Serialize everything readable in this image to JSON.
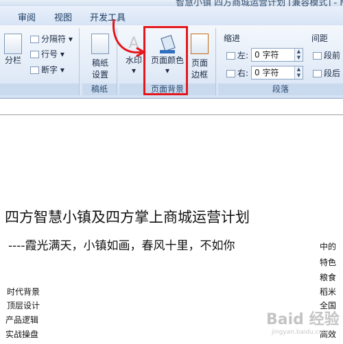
{
  "title_fragment": "智慧小镇 四方商城运营计划 [兼容模式] - Microsoft",
  "tabs": [
    "审阅",
    "视图",
    "开发工具"
  ],
  "ribbon": {
    "layout_buttons": {
      "columns": "分栏",
      "breaks": "分隔符",
      "line_numbers": "行号",
      "hyphenation": "断字"
    },
    "manuscript": {
      "label": "稿纸设置",
      "group": "稿纸"
    },
    "page_background": {
      "watermark": "水印",
      "page_color": "页面颜色",
      "page_borders": "页面边框",
      "group": "页面背景"
    },
    "paragraph": {
      "indent_title": "缩进",
      "left_label": "左:",
      "left_value": "0 字符",
      "right_label": "右:",
      "right_value": "0 字符",
      "spacing_title": "间距",
      "before_label": "段前",
      "after_label": "段后",
      "group": "段落"
    }
  },
  "document": {
    "title": "四方智慧小镇及四方掌上商城运营计划",
    "subtitle": "----霞光满天，小镇如画，春风十里，不如你",
    "outline": [
      "时代背景",
      "顶层设计",
      "产品逻辑",
      "实战操盘"
    ],
    "right_column": [
      "中的",
      "特色",
      "粮食",
      "稻米",
      "全国",
      "高效"
    ]
  },
  "watermark": {
    "text": "Baid 经验",
    "url": "jingyan.baidu.com"
  },
  "colors": {
    "highlight": "#e3161b",
    "ribbon": "#dfe9f6"
  }
}
